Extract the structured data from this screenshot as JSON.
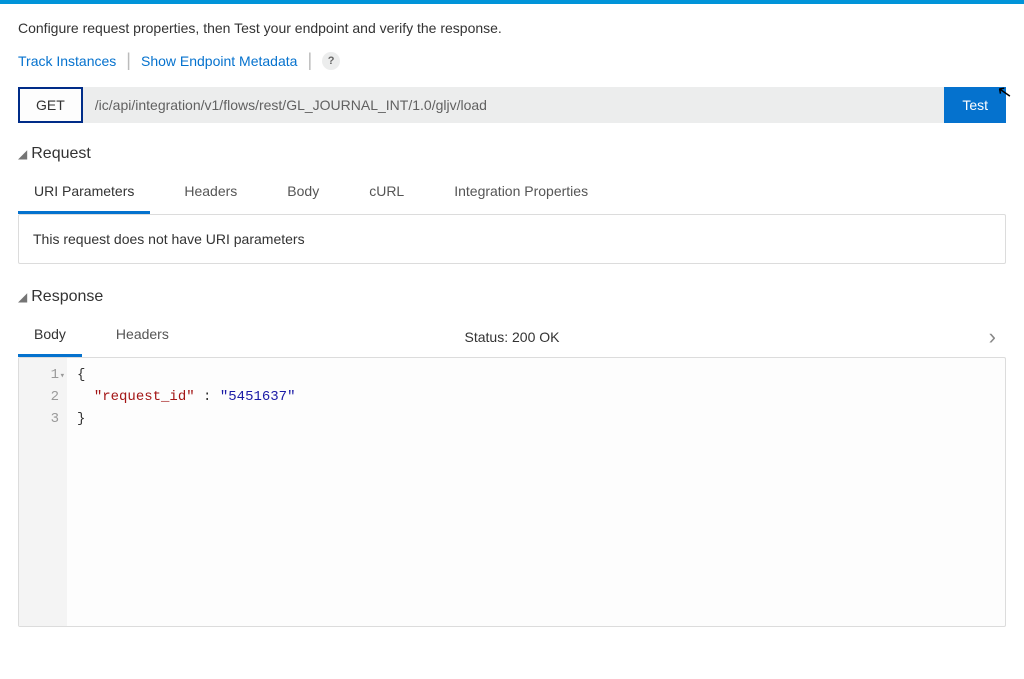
{
  "instruction": "Configure request properties, then Test your endpoint and verify the response.",
  "links": {
    "track_instances": "Track Instances",
    "show_metadata": "Show Endpoint Metadata",
    "help": "?"
  },
  "endpoint": {
    "method": "GET",
    "url": "/ic/api/integration/v1/flows/rest/GL_JOURNAL_INT/1.0/gljv/load",
    "test_label": "Test"
  },
  "request": {
    "title": "Request",
    "tabs": {
      "uri_params": "URI Parameters",
      "headers": "Headers",
      "body": "Body",
      "curl": "cURL",
      "integration_props": "Integration Properties"
    },
    "empty_msg": "This request does not have URI parameters"
  },
  "response": {
    "title": "Response",
    "tabs": {
      "body": "Body",
      "headers": "Headers"
    },
    "status_label": "Status:",
    "status_value": "200 OK",
    "gutter": {
      "l1": "1",
      "l2": "2",
      "l3": "3"
    },
    "code": {
      "brace_open": "{",
      "key": "\"request_id\"",
      "colon": " : ",
      "value": "\"5451637\"",
      "brace_close": "}"
    }
  }
}
